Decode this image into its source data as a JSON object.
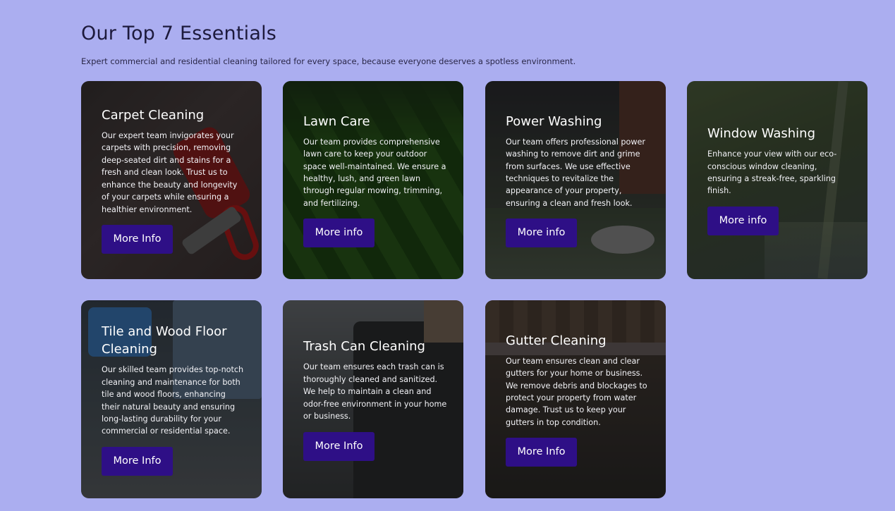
{
  "section": {
    "title": "Our Top 7 Essentials",
    "subtitle": "Expert commercial and residential cleaning tailored for every space, because everyone deserves a spotless environment."
  },
  "cards": [
    {
      "title": "Carpet Cleaning",
      "description": "Our expert team invigorates your carpets with precision, removing deep-seated dirt and stains for a fresh and clean look. Trust us to enhance the beauty and longevity of your carpets while ensuring a healthier environment.",
      "button_label": "More Info"
    },
    {
      "title": "Lawn Care",
      "description": "Our team provides comprehensive lawn care to keep your outdoor space well-maintained. We ensure a healthy, lush, and green lawn through regular mowing, trimming, and fertilizing.",
      "button_label": "More info"
    },
    {
      "title": "Power Washing",
      "description": "Our team offers professional power washing to remove dirt and grime from surfaces. We use effective techniques to revitalize the appearance of your property, ensuring a clean and fresh look.",
      "button_label": "More info"
    },
    {
      "title": "Window Washing",
      "description": "Enhance your view with our eco-conscious window cleaning, ensuring a streak-free, sparkling finish.",
      "button_label": "More info"
    },
    {
      "title": "Tile and Wood Floor Cleaning",
      "description": "Our skilled team provides top-notch cleaning and maintenance for both tile and wood floors, enhancing their natural beauty and ensuring long-lasting durability for your commercial or residential space.",
      "button_label": "More Info"
    },
    {
      "title": "Trash Can Cleaning",
      "description": "Our team ensures each trash can is thoroughly cleaned and sanitized. We help to maintain a clean and odor-free environment in your home or business.",
      "button_label": "More Info"
    },
    {
      "title": "Gutter Cleaning",
      "description": "Our team ensures clean and clear gutters for your home or business. We remove debris and blockages to protect your property from water damage. Trust us to keep your gutters in top condition.",
      "button_label": "More Info"
    }
  ],
  "colors": {
    "page_background": "#abaef0",
    "button_background": "#2e0f86",
    "title_text": "#1d1a3c"
  }
}
